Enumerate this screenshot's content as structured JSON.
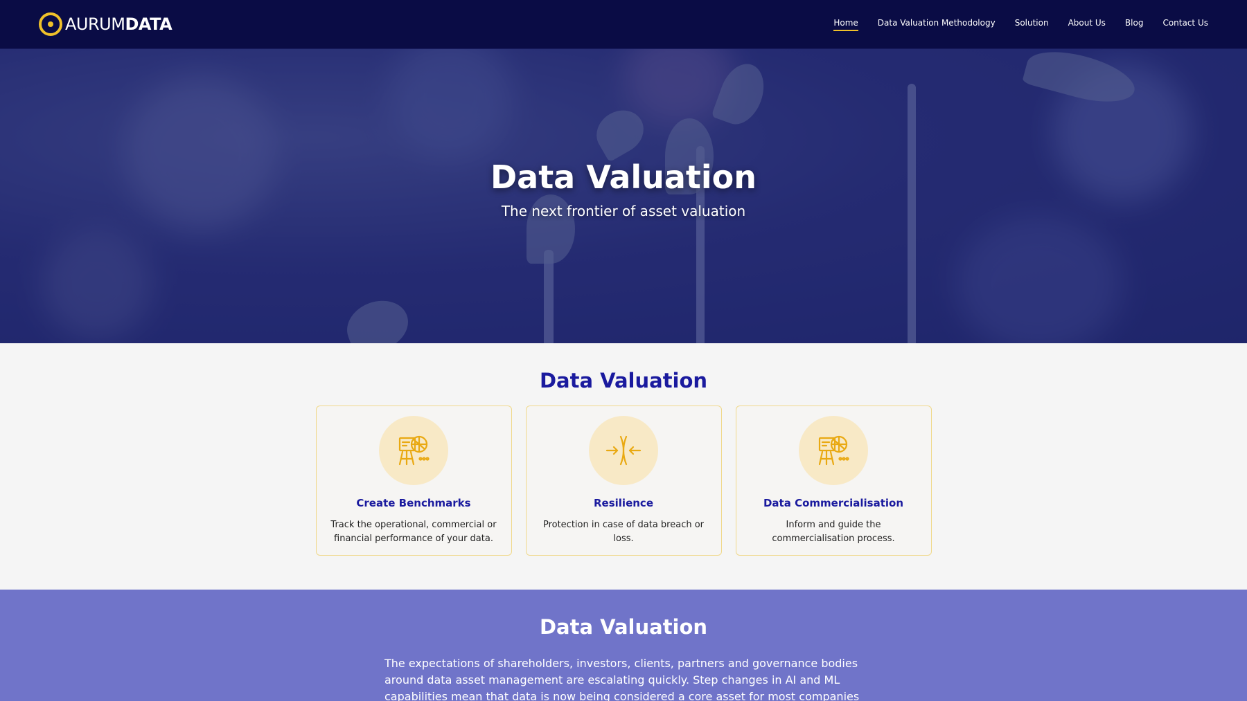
{
  "brand": {
    "name_light": "AURUM",
    "name_bold": "DATA",
    "logo_icon": "gold-ring-logo-icon",
    "accent_color": "#f0c12a",
    "navy_color": "#0a0c45"
  },
  "nav": {
    "items": [
      {
        "label": "Home",
        "active": true
      },
      {
        "label": "Data Valuation Methodology",
        "active": false
      },
      {
        "label": "Solution",
        "active": false
      },
      {
        "label": "About Us",
        "active": false
      },
      {
        "label": "Blog",
        "active": false
      },
      {
        "label": "Contact Us",
        "active": false
      }
    ]
  },
  "hero": {
    "title": "Data Valuation",
    "subtitle": "The next frontier of asset valuation"
  },
  "features": {
    "title": "Data Valuation",
    "title_color": "#1a1a9e",
    "cards": [
      {
        "icon": "presentation-chart-icon",
        "title": "Create Benchmarks",
        "text": "Track the operational, commercial or financial performance of your data."
      },
      {
        "icon": "converging-arrows-icon",
        "title": "Resilience",
        "text": "Protection in case of data breach or loss."
      },
      {
        "icon": "presentation-chart-icon",
        "title": "Data Commercialisation",
        "text": "Inform and guide the commercialisation process."
      }
    ]
  },
  "about": {
    "title": "Data Valuation",
    "background_color": "#7074c9",
    "text": "The expectations of shareholders, investors, clients, partners and governance bodies around data asset management are escalating quickly. Step changes in AI and ML capabilities mean that data is now being considered a core asset for most companies and organisations."
  }
}
